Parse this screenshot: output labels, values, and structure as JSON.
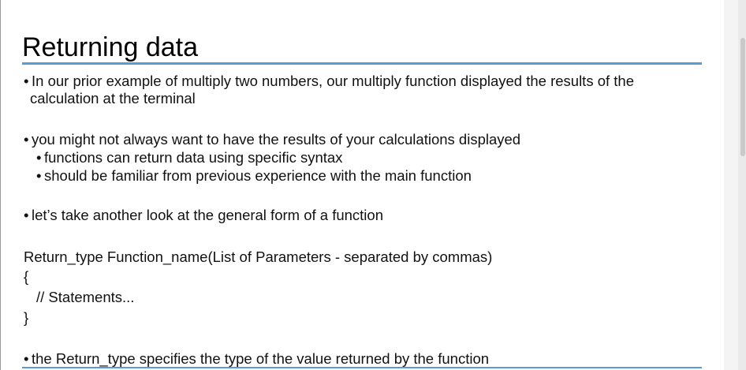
{
  "slide": {
    "title": "Returning data",
    "bullet_char": "•",
    "b1_line1": "In our prior example of multiply two numbers, our multiply function displayed the results of the",
    "b1_line2": "calculation at the terminal",
    "b2": "you might not always want to have the results of your calculations displayed",
    "b2_sub1": "functions can return data using specific syntax",
    "b2_sub2": "should be familiar from previous experience with the main function",
    "b3": "let’s take another look at the general form of a function",
    "code_signature": "Return_type  Function_name(List of Parameters - separated by commas)",
    "code_open": "{",
    "code_body": "// Statements...",
    "code_close": "}",
    "b4": "the Return_type specifies the type of the value returned by the function"
  },
  "colors": {
    "accent_rule": "#5b9bd5",
    "text": "#111111"
  }
}
